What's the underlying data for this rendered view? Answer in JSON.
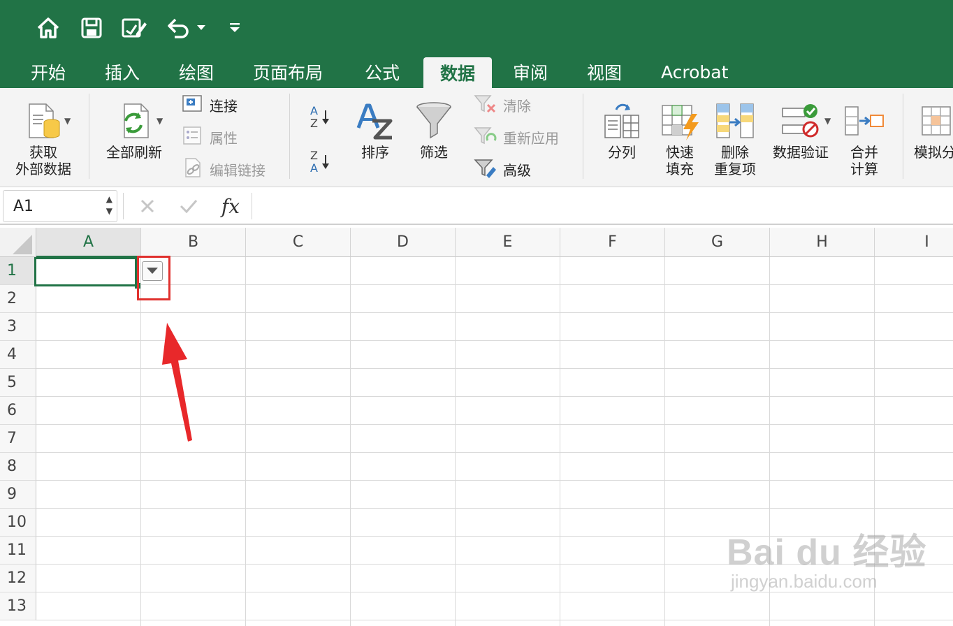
{
  "tabs": [
    "开始",
    "插入",
    "绘图",
    "页面布局",
    "公式",
    "数据",
    "审阅",
    "视图",
    "Acrobat"
  ],
  "active_tab": "数据",
  "ribbon": {
    "get_external_1": "获取",
    "get_external_2": "外部数据",
    "refresh_all": "全部刷新",
    "connections": "连接",
    "properties": "属性",
    "edit_links": "编辑链接",
    "sort_az_top": "A",
    "sort_az_bottom": "Z",
    "sort_za_top": "Z",
    "sort_za_bottom": "A",
    "sort": "排序",
    "filter": "筛选",
    "clear": "清除",
    "reapply": "重新应用",
    "advanced": "高级",
    "text_to_columns": "分列",
    "flash_fill_1": "快速",
    "flash_fill_2": "填充",
    "remove_dup_1": "删除",
    "remove_dup_2": "重复项",
    "data_validation": "数据验证",
    "consolidate_1": "合并",
    "consolidate_2": "计算",
    "what_if": "模拟分"
  },
  "formula_bar": {
    "name_box": "A1",
    "fx": "fx",
    "formula": ""
  },
  "grid": {
    "columns": [
      "A",
      "B",
      "C",
      "D",
      "E",
      "F",
      "G",
      "H",
      "I"
    ],
    "rows": [
      "1",
      "2",
      "3",
      "4",
      "5",
      "6",
      "7",
      "8",
      "9",
      "10",
      "11",
      "12",
      "13"
    ],
    "selected_column": "A",
    "selected_row": "1"
  },
  "watermark": {
    "brand": "Bai  du 经验",
    "url": "jingyan.baidu.com"
  },
  "colors": {
    "title_green": "#217346",
    "highlight_red": "#e0312e"
  }
}
